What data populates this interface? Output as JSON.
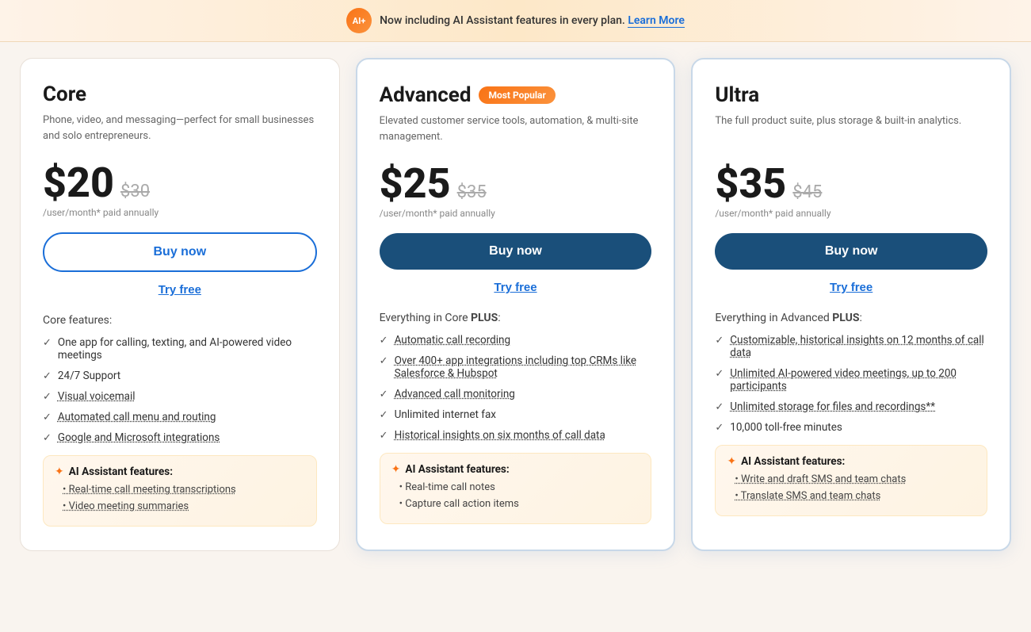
{
  "banner": {
    "badge_text": "AI+",
    "message": "Now including AI Assistant features in every plan.",
    "link_text": "Learn More",
    "link_href": "#"
  },
  "plans": [
    {
      "id": "core",
      "name": "Core",
      "description": "Phone, video, and messaging—perfect for small businesses and solo entrepreneurs.",
      "price": "$20",
      "price_old": "$30",
      "period": "/user/month* paid annually",
      "buy_label": "Buy now",
      "try_label": "Try free",
      "btn_style": "outline",
      "featured": false,
      "popular_badge": null,
      "features_header": "Core features:",
      "features_bold": null,
      "features": [
        {
          "text": "One app for calling, texting, and AI-powered video meetings",
          "link": false
        },
        {
          "text": "24/7 Support",
          "link": false
        },
        {
          "text": "Visual voicemail",
          "link": true
        },
        {
          "text": "Automated call menu and routing",
          "link": true
        },
        {
          "text": "Google and Microsoft integrations",
          "link": true
        }
      ],
      "ai_title": "AI Assistant features:",
      "ai_items": [
        {
          "text": "Real-time call meeting transcriptions",
          "link": true
        },
        {
          "text": "Video meeting summaries",
          "link": true
        }
      ]
    },
    {
      "id": "advanced",
      "name": "Advanced",
      "description": "Elevated customer service tools, automation, & multi-site management.",
      "price": "$25",
      "price_old": "$35",
      "period": "/user/month* paid annually",
      "buy_label": "Buy now",
      "try_label": "Try free",
      "btn_style": "filled",
      "featured": true,
      "popular_badge": "Most Popular",
      "features_header": "Everything in Core ",
      "features_bold": "PLUS",
      "features_suffix": ":",
      "features": [
        {
          "text": "Automatic call recording",
          "link": true
        },
        {
          "text": "Over 400+ app integrations including top CRMs like Salesforce & Hubspot",
          "link": true
        },
        {
          "text": "Advanced call monitoring",
          "link": true
        },
        {
          "text": "Unlimited internet fax",
          "link": false
        },
        {
          "text": "Historical insights on six months of call data",
          "link": true
        }
      ],
      "ai_title": "AI Assistant features:",
      "ai_items": [
        {
          "text": "Real-time call notes",
          "link": false
        },
        {
          "text": "Capture call action items",
          "link": false
        }
      ]
    },
    {
      "id": "ultra",
      "name": "Ultra",
      "description": "The full product suite, plus storage & built-in analytics.",
      "price": "$35",
      "price_old": "$45",
      "period": "/user/month* paid annually",
      "buy_label": "Buy now",
      "try_label": "Try free",
      "btn_style": "filled",
      "featured": true,
      "popular_badge": null,
      "features_header": "Everything in Advanced ",
      "features_bold": "PLUS",
      "features_suffix": ":",
      "features": [
        {
          "text": "Customizable, historical insights on 12 months of call data",
          "link": true
        },
        {
          "text": "Unlimited AI-powered video meetings, up to 200 participants",
          "link": true
        },
        {
          "text": "Unlimited storage for files and recordings**",
          "link": true
        },
        {
          "text": "10,000 toll-free minutes",
          "link": false
        }
      ],
      "ai_title": "AI Assistant features:",
      "ai_items": [
        {
          "text": "Write and draft SMS and team chats",
          "link": true
        },
        {
          "text": "Translate SMS and team chats",
          "link": true
        }
      ]
    }
  ]
}
